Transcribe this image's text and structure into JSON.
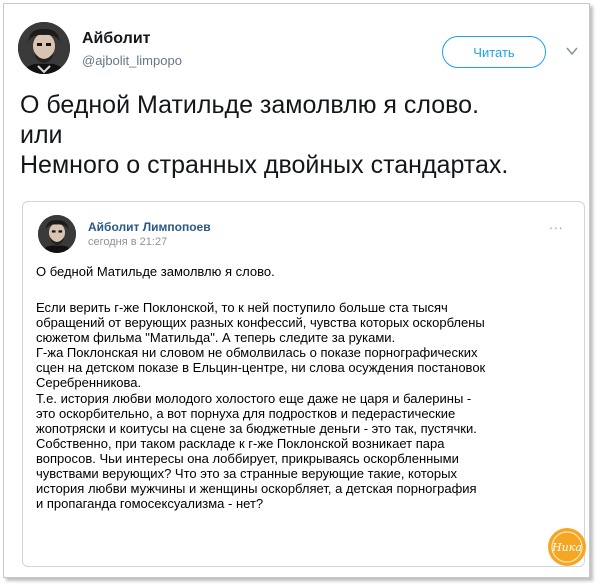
{
  "tweet": {
    "display_name": "Айболит",
    "handle": "@ajbolit_limpopo",
    "follow_label": "Читать",
    "text_lines": [
      "О бедной Матильде замолвлю я слово.",
      "или",
      "Немного о странных двойных стандартах."
    ]
  },
  "vk_post": {
    "author": "Айболит Лимпопоев",
    "date": "сегодня в 21:27",
    "menu": "...",
    "title": "О бедной Матильде замолвлю я слово.",
    "body_lines": [
      "Если верить г-же Поклонской, то к ней поступило больше ста тысяч",
      "обращений от верующих разных конфессий, чувства которых оскорблены",
      "сюжетом фильма \"Матильда\". А теперь следите за руками.",
      "Г-жа Поклонская ни словом не обмолвилась о показе порнографических",
      "сцен на детском показе в Ельцин-центре, ни слова осуждения постановок",
      "Серебренникова.",
      "Т.е. история любви молодого холостого еще даже не царя и балерины -",
      "это оскорбительно, а вот порнуха для подростков и педерастические",
      "жопотряски и коитусы на сцене за бюджетные деньги - это так, пустячки.",
      "Собственно, при таком раскладе к г-же Поклонской возникает пара",
      "вопросов. Чьи интересы она лоббирует, прикрываясь оскорбленными",
      "чувствами верующих? Что это за странные верующие такие, которых",
      "история любви мужчины и женщины оскорбляет, а детская порнография",
      "и пропаганда гомосексуализма - нет?"
    ]
  },
  "badge": {
    "text": "Ника"
  },
  "colors": {
    "twitter_blue": "#1da1f2",
    "vk_link": "#2a5885",
    "badge_orange": "#f5a623"
  },
  "icons": [
    "avatar-portrait",
    "chevron-down-icon",
    "more-dots-icon",
    "watermark-badge"
  ]
}
